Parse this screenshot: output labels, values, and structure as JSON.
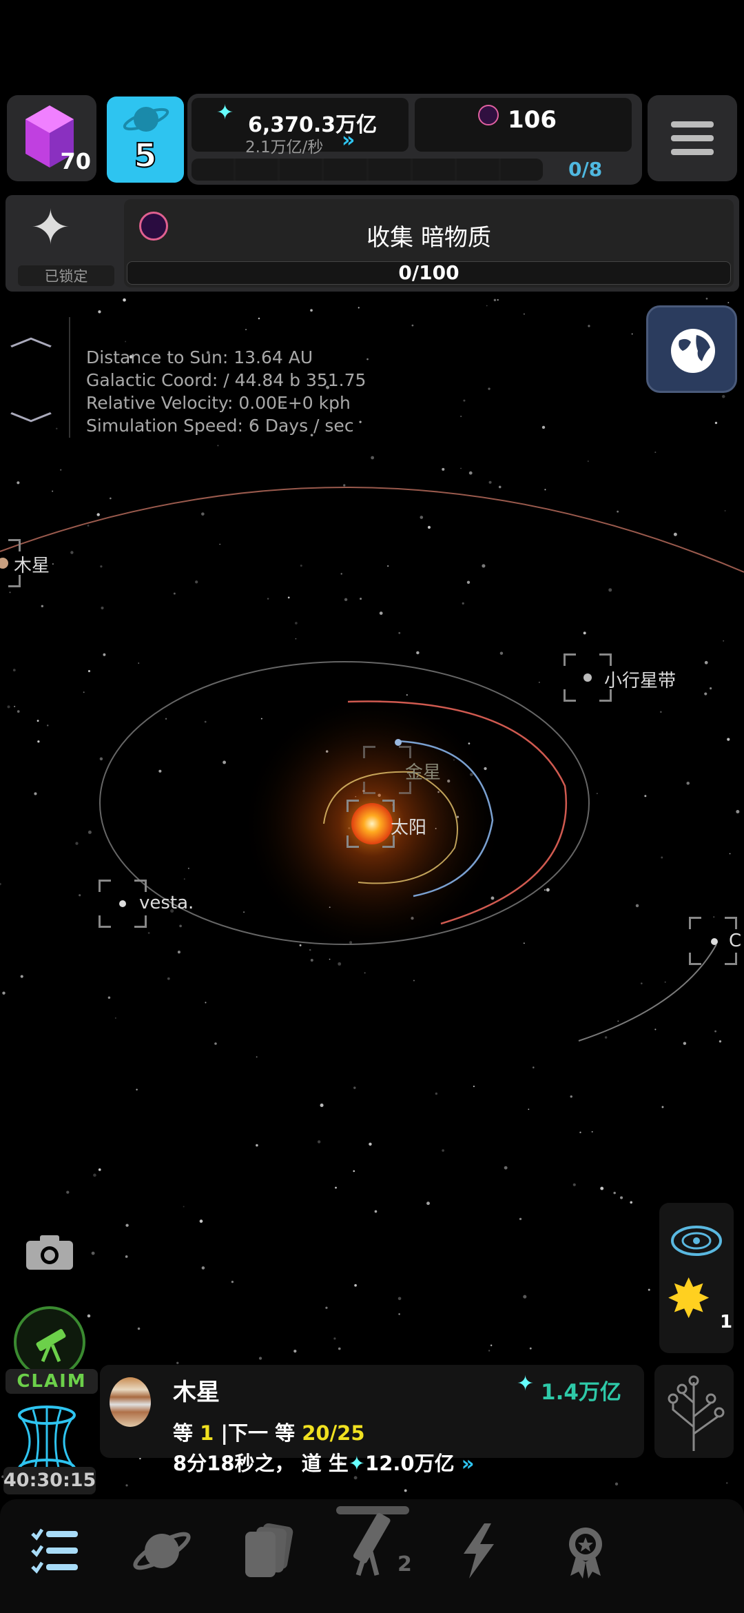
{
  "header": {
    "gems": "70",
    "level": "5",
    "currency": "6,370.3万亿",
    "rate": "2.1万亿/秒",
    "dark_matter": "106",
    "slots": "0/8",
    "slots_filled": 0,
    "slots_total": 8
  },
  "goal": {
    "locked_label": "已锁定",
    "title": "收集 暗物质",
    "progress": "0/100",
    "progress_value": 0
  },
  "info": {
    "distance": "Distance to Sun: 13.64 AU",
    "coord": "Galactic Coord: / 44.84 b 351.75",
    "velocity": "Relative Velocity: 0.00E+0 kph",
    "speed": "Simulation Speed: 6 Days / sec"
  },
  "bodies": {
    "jupiter": "木星",
    "asteroid_belt": "小行星带",
    "venus": "金星",
    "sun": "太阳",
    "vesta": "vesta.",
    "c": "C"
  },
  "side": {
    "claim": "CLAIM",
    "timer": "40:30:15",
    "star_count": "1"
  },
  "planet_card": {
    "name": "木星",
    "income": "1.4万亿",
    "level_label": "等",
    "level": "1",
    "next_label": "|下一 等",
    "next_progress": "20/25",
    "upgrade_prefix": "8分18秒之， 道 生",
    "upgrade_value": "12.0万亿"
  },
  "nav": {
    "telescope_badge": "2"
  },
  "colors": {
    "accent": "#29c8f0",
    "gold": "#f0e020",
    "teal": "#2ec9a8",
    "claim": "#6cd04a"
  }
}
